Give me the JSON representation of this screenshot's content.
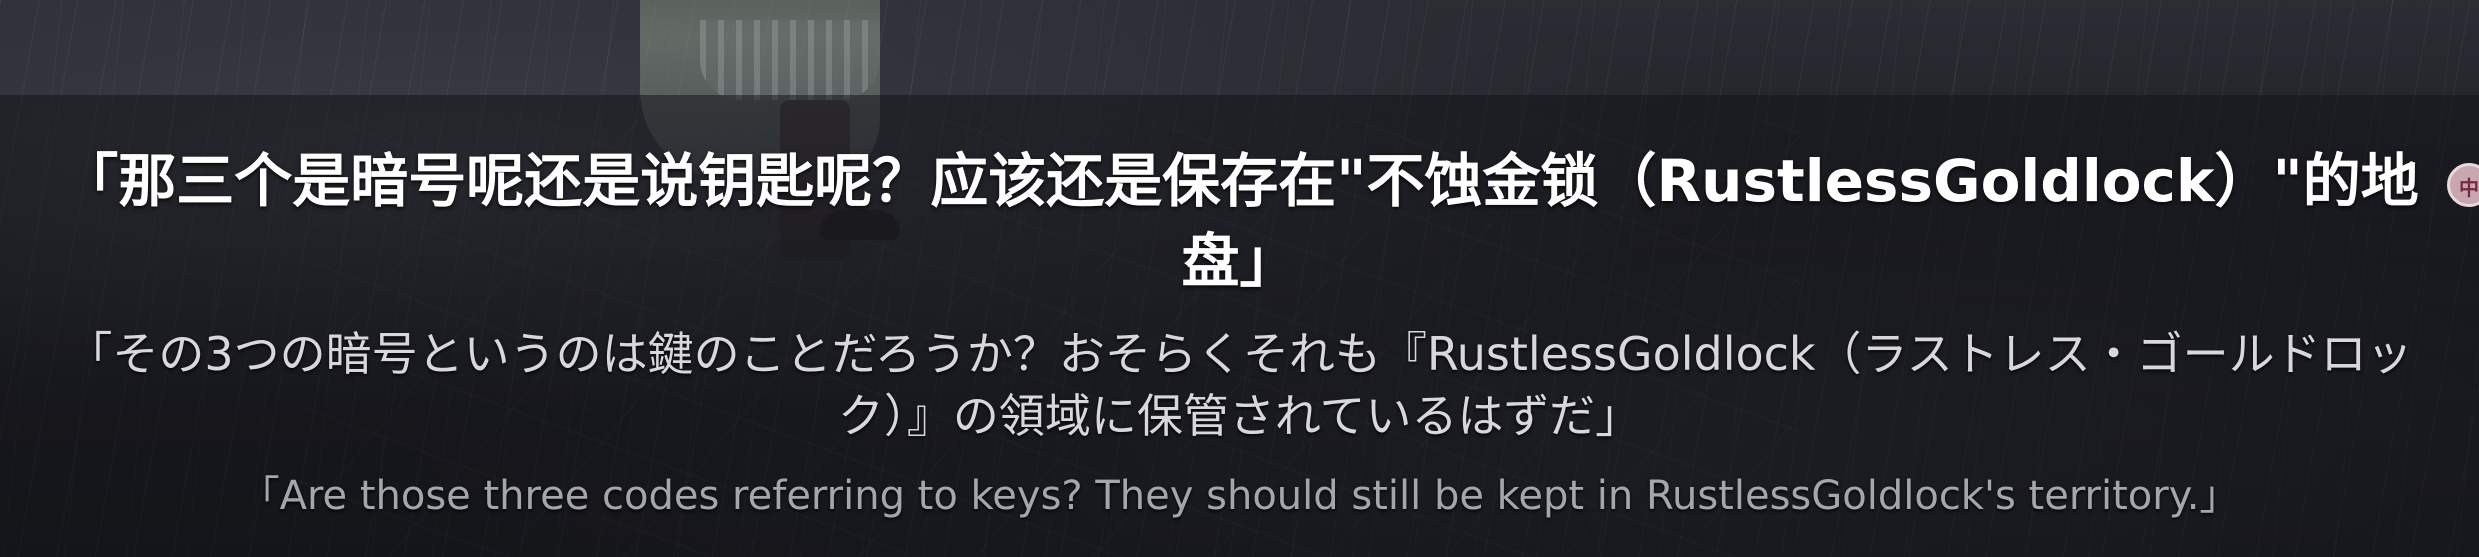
{
  "subtitles": {
    "chinese": "「那三个是暗号呢还是说钥匙呢？应该还是保存在\"不蚀金锁（RustlessGoldlock）\"的地盘」",
    "japanese": "「その3つの暗号というのは鍵のことだろうか？おそらくそれも『RustlessGoldlock（ラストレス・ゴールドロック）』の領域に保管されているはずだ」",
    "english": "「Are those three codes referring to keys? They should still be kept in RustlessGoldlock's territory.」"
  },
  "badge": {
    "icon": "translate-badge-icon",
    "glyph": "中"
  }
}
